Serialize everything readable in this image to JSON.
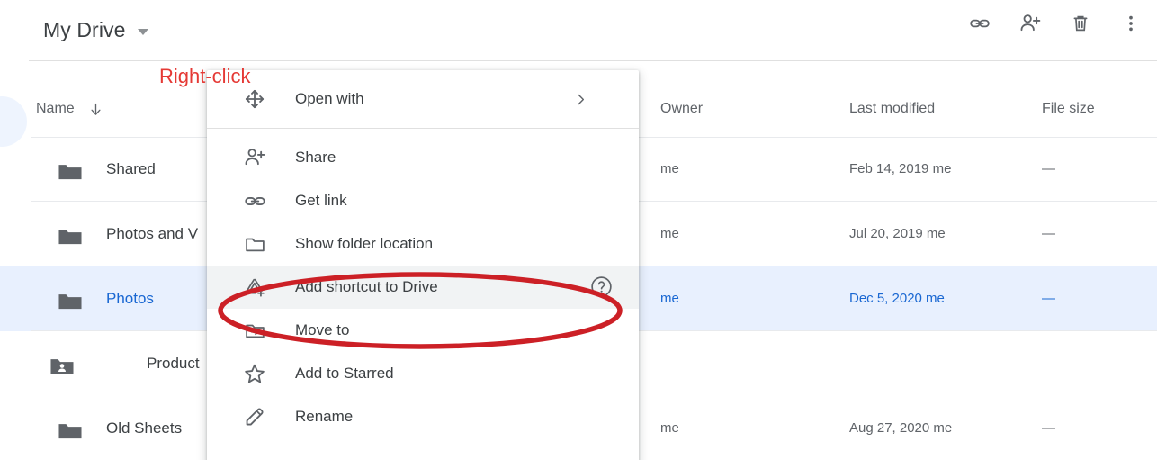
{
  "toolbar": {
    "title": "My Drive",
    "caret_icon": "chevron-down-icon",
    "actions": [
      {
        "name": "get-link-button",
        "icon": "link-icon"
      },
      {
        "name": "share-button",
        "icon": "person-add-icon"
      },
      {
        "name": "remove-button",
        "icon": "trash-icon"
      },
      {
        "name": "more-actions-button",
        "icon": "more-vertical-icon"
      }
    ]
  },
  "annotations": {
    "right_click_label": "Right-click",
    "right_click_color": "#e53935",
    "highlight_ellipse_color": "#cc2026"
  },
  "file_list": {
    "columns": {
      "name": "Name",
      "owner": "Owner",
      "last_modified": "Last modified",
      "file_size": "File size"
    },
    "sort_icon": "arrow-down-icon",
    "rows": [
      {
        "name": "Shared",
        "icon": "folder-icon",
        "owner": "me",
        "last_modified": "Feb 14, 2019 me",
        "file_size": "—",
        "selected": false,
        "indented": false
      },
      {
        "name": "Photos and V",
        "icon": "folder-icon",
        "owner": "me",
        "last_modified": "Jul 20, 2019 me",
        "file_size": "—",
        "selected": false,
        "indented": false
      },
      {
        "name": "Photos",
        "icon": "folder-icon",
        "owner": "me",
        "last_modified": "Dec 5, 2020 me",
        "file_size": "—",
        "selected": true,
        "indented": false
      },
      {
        "name": "Product",
        "icon": "shared-folder-icon",
        "owner": "",
        "last_modified": "",
        "file_size": "",
        "selected": false,
        "indented": true
      },
      {
        "name": "Old Sheets",
        "icon": "folder-icon",
        "owner": "me",
        "last_modified": "Aug 27, 2020 me",
        "file_size": "—",
        "selected": false,
        "indented": false
      }
    ]
  },
  "context_menu": {
    "items": [
      {
        "label": "Open with",
        "icon": "move-arrows-icon",
        "submenu": true,
        "hovered": false,
        "help": false
      },
      {
        "label": "Share",
        "icon": "person-add-icon",
        "submenu": false,
        "hovered": false,
        "help": false
      },
      {
        "label": "Get link",
        "icon": "link-icon",
        "submenu": false,
        "hovered": false,
        "help": false
      },
      {
        "label": "Show folder location",
        "icon": "folder-outline-icon",
        "submenu": false,
        "hovered": false,
        "help": false
      },
      {
        "label": "Add shortcut to Drive",
        "icon": "drive-shortcut-icon",
        "submenu": false,
        "hovered": true,
        "help": true
      },
      {
        "label": "Move to",
        "icon": "folder-move-icon",
        "submenu": false,
        "hovered": false,
        "help": false
      },
      {
        "label": "Add to Starred",
        "icon": "star-outline-icon",
        "submenu": false,
        "hovered": false,
        "help": false
      },
      {
        "label": "Rename",
        "icon": "pencil-icon",
        "submenu": false,
        "hovered": false,
        "help": false
      }
    ]
  },
  "colors": {
    "selected_row_bg": "#e8f0fe",
    "selected_row_text": "#1967d2",
    "hover_menu_bg": "#f1f3f4",
    "icon_gray": "#5f6368",
    "folder_gray": "#5f6368"
  }
}
